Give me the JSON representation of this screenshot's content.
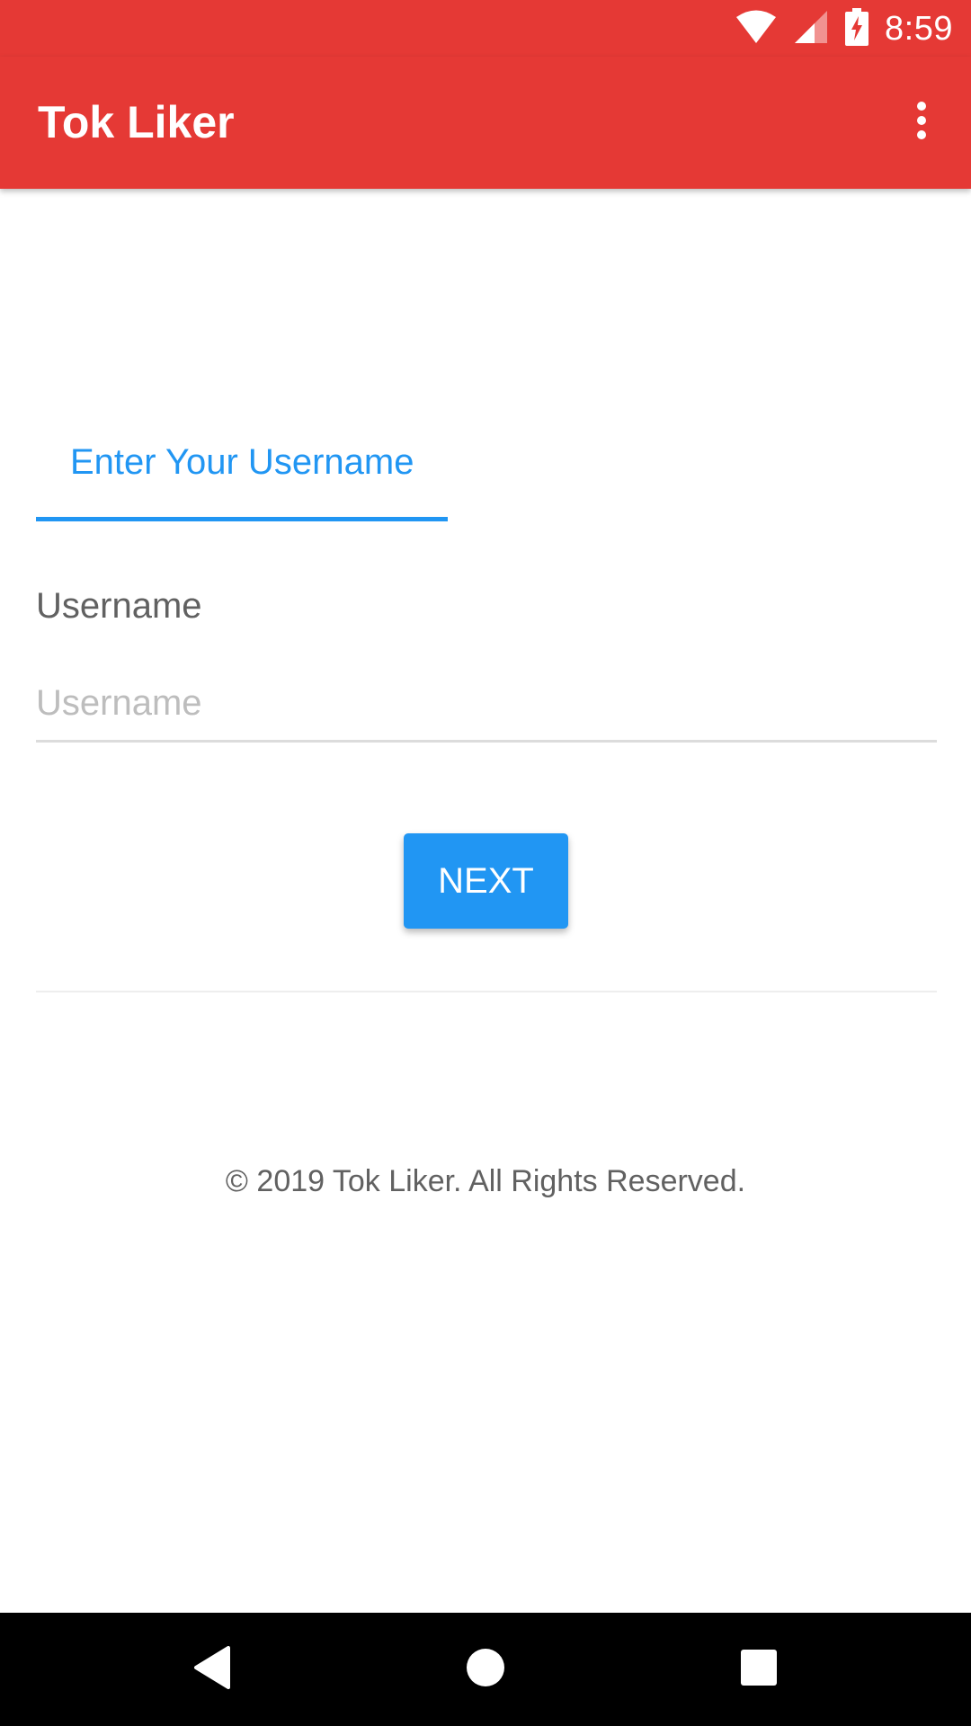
{
  "status_bar": {
    "time": "8:59",
    "icons": [
      "wifi-icon",
      "signal-icon",
      "battery-charging-icon"
    ]
  },
  "app_bar": {
    "title": "Tok Liker",
    "menu_icon": "overflow-menu-icon"
  },
  "tab": {
    "label": "Enter Your Username"
  },
  "form": {
    "username_label": "Username",
    "username_value": "",
    "username_placeholder": "Username",
    "next_label": "NEXT"
  },
  "footer": {
    "copyright": "© 2019 Tok Liker. All Rights Reserved."
  },
  "nav_bar": {
    "icons": [
      "back-icon",
      "home-icon",
      "recents-icon"
    ]
  },
  "colors": {
    "app_bar": "#e53935",
    "accent": "#2196f3",
    "text_secondary": "#616161",
    "nav_bar": "#000000"
  }
}
